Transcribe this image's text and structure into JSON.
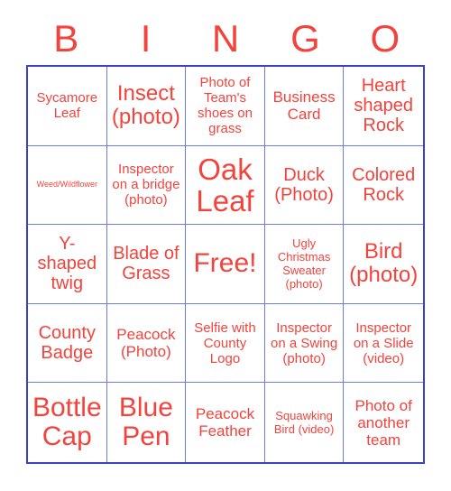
{
  "card": {
    "title": "BINGO",
    "header_letters": [
      "B",
      "I",
      "N",
      "G",
      "O"
    ],
    "colors": {
      "text_red": "#f4433c",
      "grid_line_blue": "#6d7ce4",
      "outer_border_blue": "#3b42c4",
      "background": "#ffffff"
    },
    "grid_size": "5x5",
    "free_space": "Free!",
    "rows": [
      [
        {
          "text": "Sycamore Leaf",
          "size": "fs-s"
        },
        {
          "text": "Insect (photo)",
          "size": "fs-xl"
        },
        {
          "text": "Photo of Team's shoes on grass",
          "size": "fs-s"
        },
        {
          "text": "Business Card",
          "size": "fs-m"
        },
        {
          "text": "Heart shaped Rock",
          "size": "fs-l"
        }
      ],
      [
        {
          "text": "Weed/Wildflower",
          "size": "fs-xxs"
        },
        {
          "text": "Inspector on a bridge (photo)",
          "size": "fs-s"
        },
        {
          "text": "Oak Leaf",
          "size": "fs-hg"
        },
        {
          "text": "Duck (Photo)",
          "size": "fs-l"
        },
        {
          "text": "Colored Rock",
          "size": "fs-l"
        }
      ],
      [
        {
          "text": "Y-shaped twig",
          "size": "fs-l"
        },
        {
          "text": "Blade of Grass",
          "size": "fs-l"
        },
        {
          "text": "Free!",
          "size": "fs-xxl"
        },
        {
          "text": "Ugly Christmas Sweater (photo)",
          "size": "fs-xs"
        },
        {
          "text": "Bird (photo)",
          "size": "fs-xl"
        }
      ],
      [
        {
          "text": "County Badge",
          "size": "fs-l"
        },
        {
          "text": "Peacock (Photo)",
          "size": "fs-m"
        },
        {
          "text": "Selfie with County Logo",
          "size": "fs-s"
        },
        {
          "text": "Inspector on a Swing (photo)",
          "size": "fs-s"
        },
        {
          "text": "Inspector on a Slide (video)",
          "size": "fs-s"
        }
      ],
      [
        {
          "text": "Bottle Cap",
          "size": "fs-xxl"
        },
        {
          "text": "Blue Pen",
          "size": "fs-xxl"
        },
        {
          "text": "Peacock Feather",
          "size": "fs-m"
        },
        {
          "text": "Squawking Bird (video)",
          "size": "fs-xs"
        },
        {
          "text": "Photo of another team",
          "size": "fs-m"
        }
      ]
    ]
  }
}
